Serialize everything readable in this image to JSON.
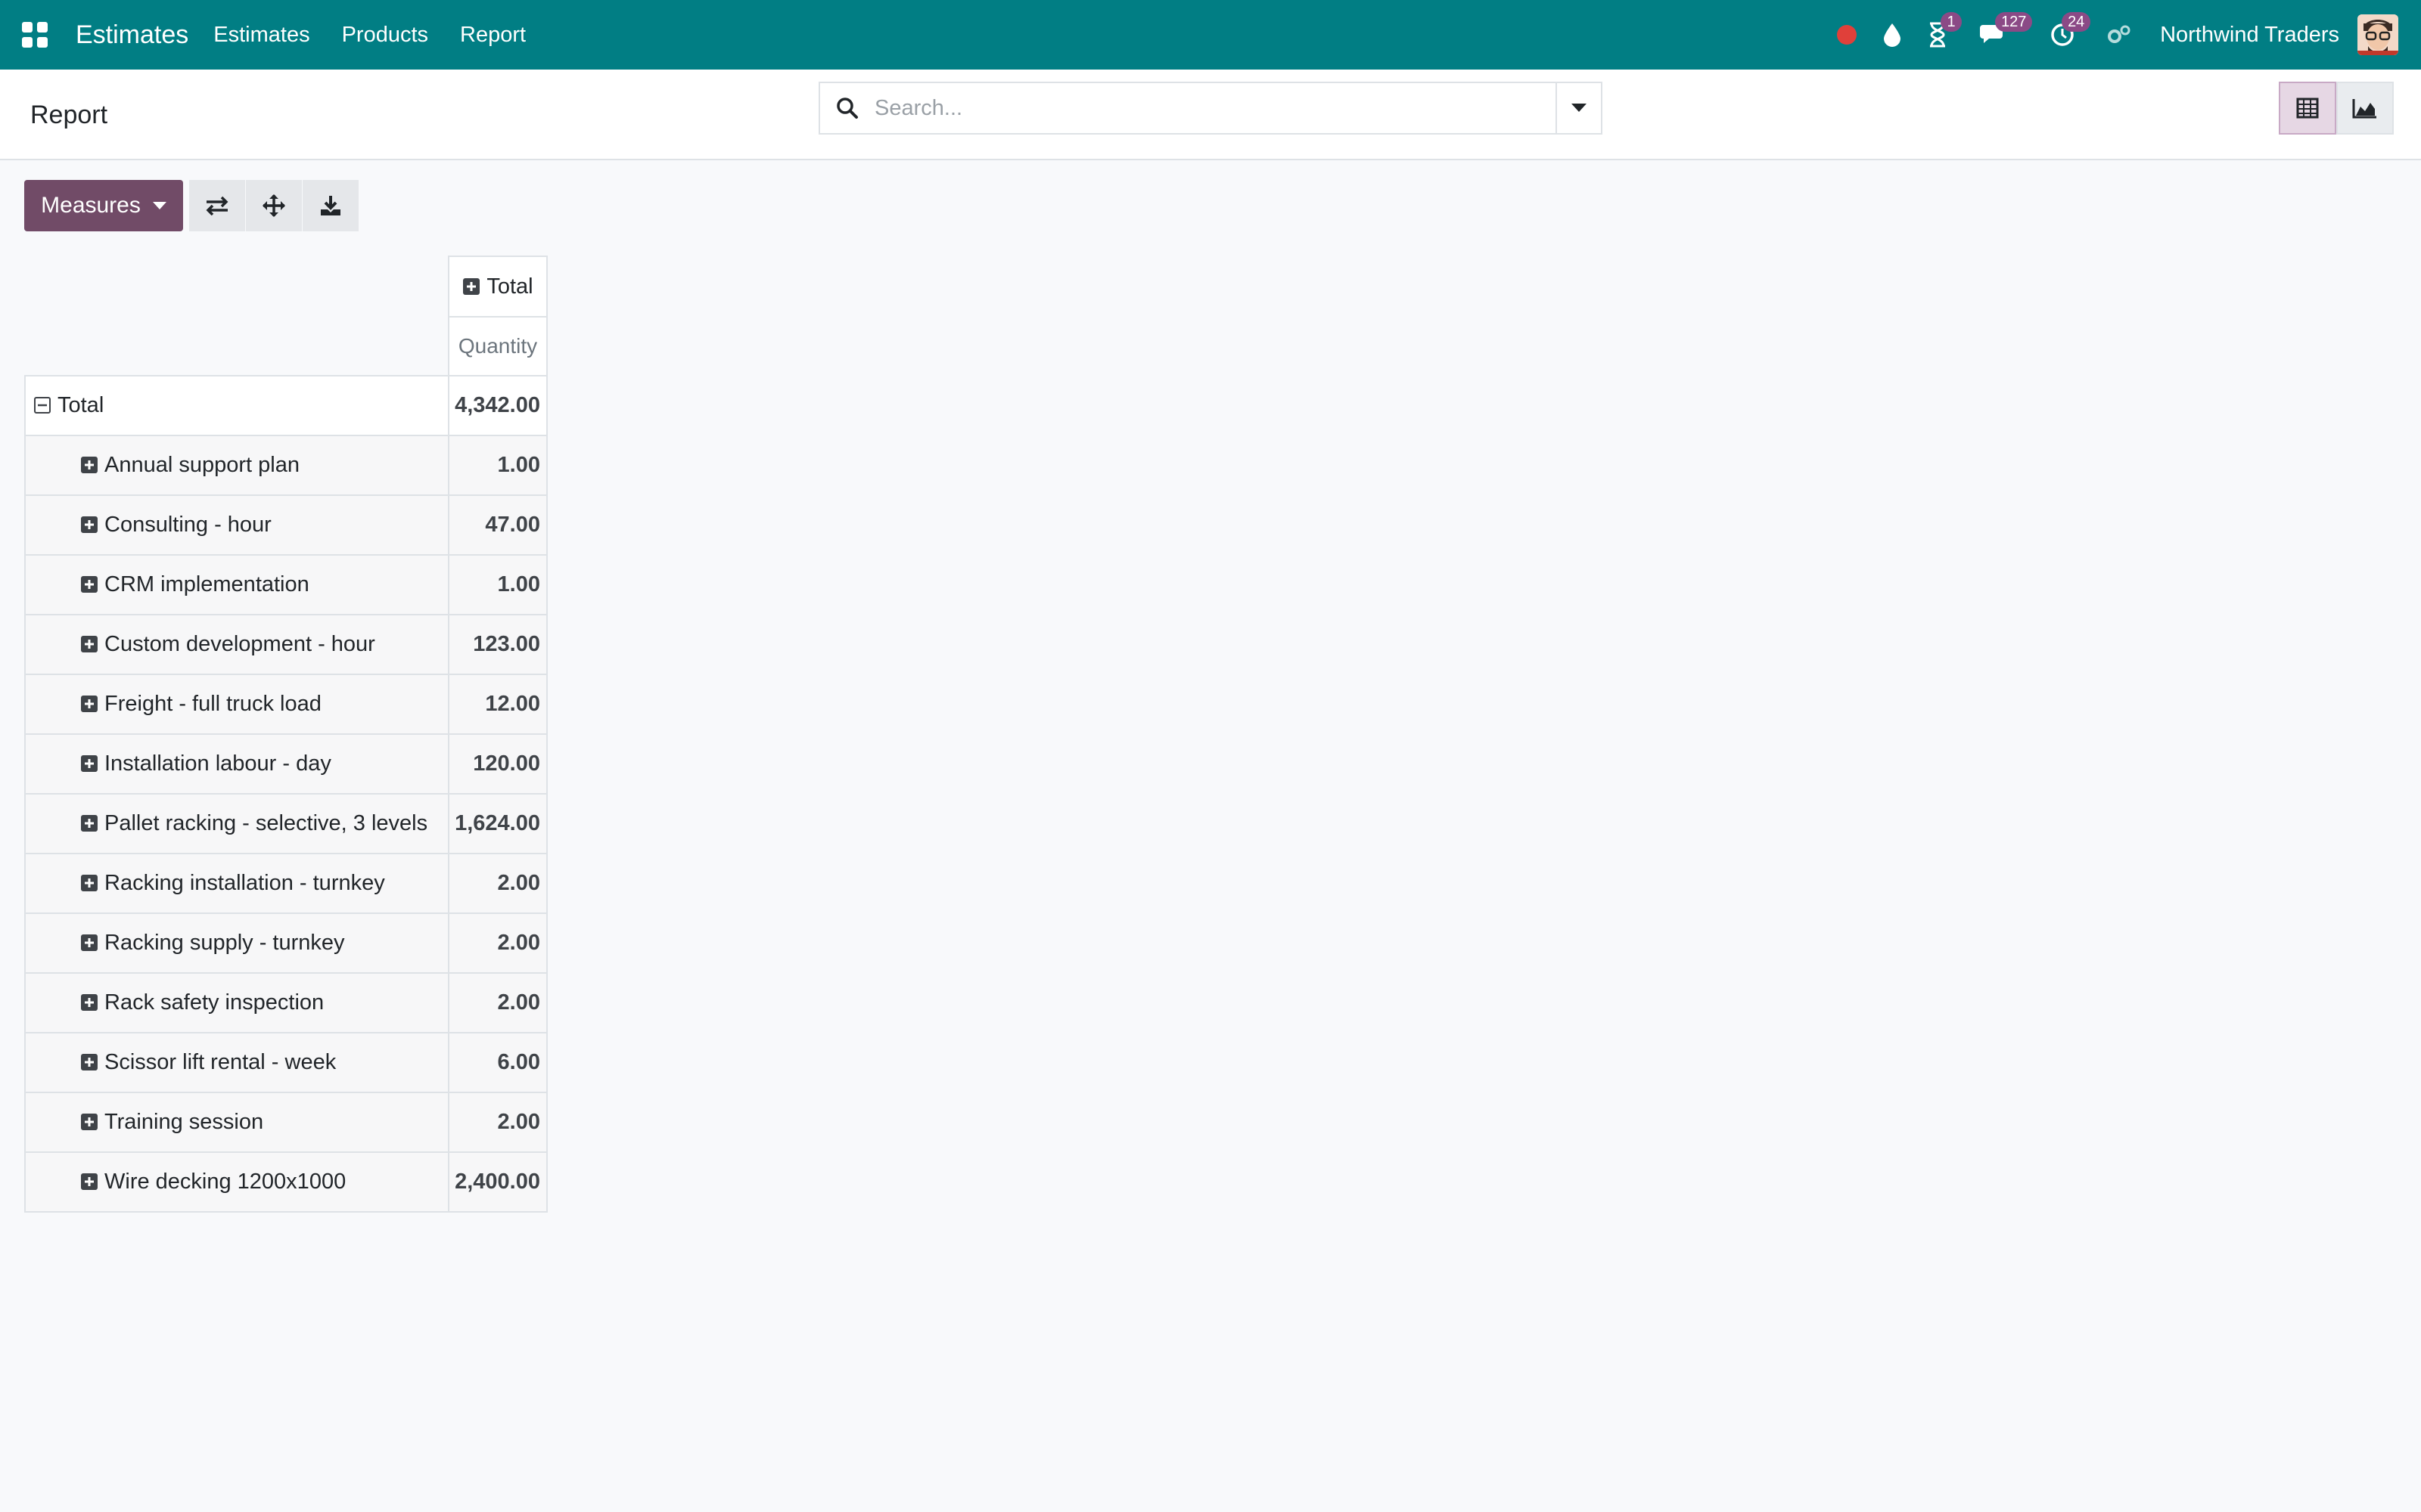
{
  "navbar": {
    "brand": "Estimates",
    "menu": [
      {
        "label": "Estimates"
      },
      {
        "label": "Products"
      },
      {
        "label": "Report"
      }
    ],
    "activity_badge": "1",
    "messages_badge": "127",
    "activities_badge": "24",
    "company": "Northwind Traders",
    "accent": "#017e84"
  },
  "control_panel": {
    "breadcrumb": "Report",
    "search_placeholder": "Search..."
  },
  "toolbar": {
    "measures_label": "Measures",
    "primary_color": "#714b67"
  },
  "pivot": {
    "column_header": "Total",
    "measure_header": "Quantity",
    "total_row": {
      "label": "Total",
      "value": "4,342.00"
    },
    "rows": [
      {
        "label": "Annual support plan",
        "value": "1.00"
      },
      {
        "label": "Consulting - hour",
        "value": "47.00"
      },
      {
        "label": "CRM implementation",
        "value": "1.00"
      },
      {
        "label": "Custom development - hour",
        "value": "123.00"
      },
      {
        "label": "Freight - full truck load",
        "value": "12.00"
      },
      {
        "label": "Installation labour - day",
        "value": "120.00"
      },
      {
        "label": "Pallet racking - selective, 3 levels",
        "value": "1,624.00"
      },
      {
        "label": "Racking installation - turnkey",
        "value": "2.00"
      },
      {
        "label": "Racking supply - turnkey",
        "value": "2.00"
      },
      {
        "label": "Rack safety inspection",
        "value": "2.00"
      },
      {
        "label": "Scissor lift rental - week",
        "value": "6.00"
      },
      {
        "label": "Training session",
        "value": "2.00"
      },
      {
        "label": "Wire decking 1200x1000",
        "value": "2,400.00"
      }
    ]
  }
}
